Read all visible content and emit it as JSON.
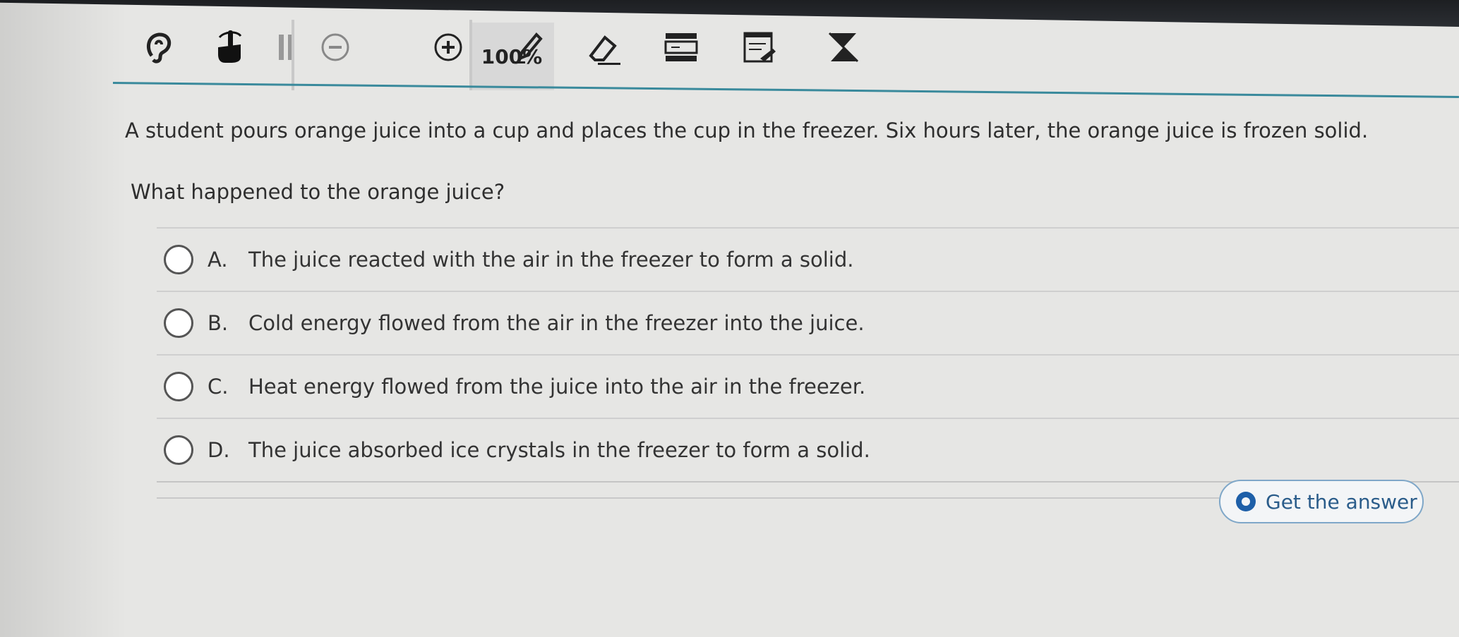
{
  "toolbar": {
    "zoom_label": "100%",
    "tools": [
      "ear-icon",
      "hand-pointer-icon",
      "pause-icon",
      "zoom-out-icon",
      "zoom-in-icon",
      "pencil-icon",
      "eraser-icon",
      "line-reader-icon",
      "notepad-icon",
      "strike-through-icon"
    ]
  },
  "question": {
    "text": "A student pours orange juice into a cup and places the cup in the freezer. Six hours later, the orange juice is frozen solid.",
    "prompt": "What happened to the orange juice?"
  },
  "answers": [
    {
      "letter": "A.",
      "text": "The juice reacted with the air in the freezer to form a solid."
    },
    {
      "letter": "B.",
      "text": "Cold energy flowed from the air in the freezer into the juice."
    },
    {
      "letter": "C.",
      "text": "Heat energy flowed from the juice into the air in the freezer."
    },
    {
      "letter": "D.",
      "text": "The juice absorbed ice crystals in the freezer to form a solid."
    }
  ],
  "get_answer": {
    "label": "Get the answer"
  },
  "colors": {
    "accent_line": "#3a8a9c",
    "answer_button": "#1e5fa8"
  }
}
